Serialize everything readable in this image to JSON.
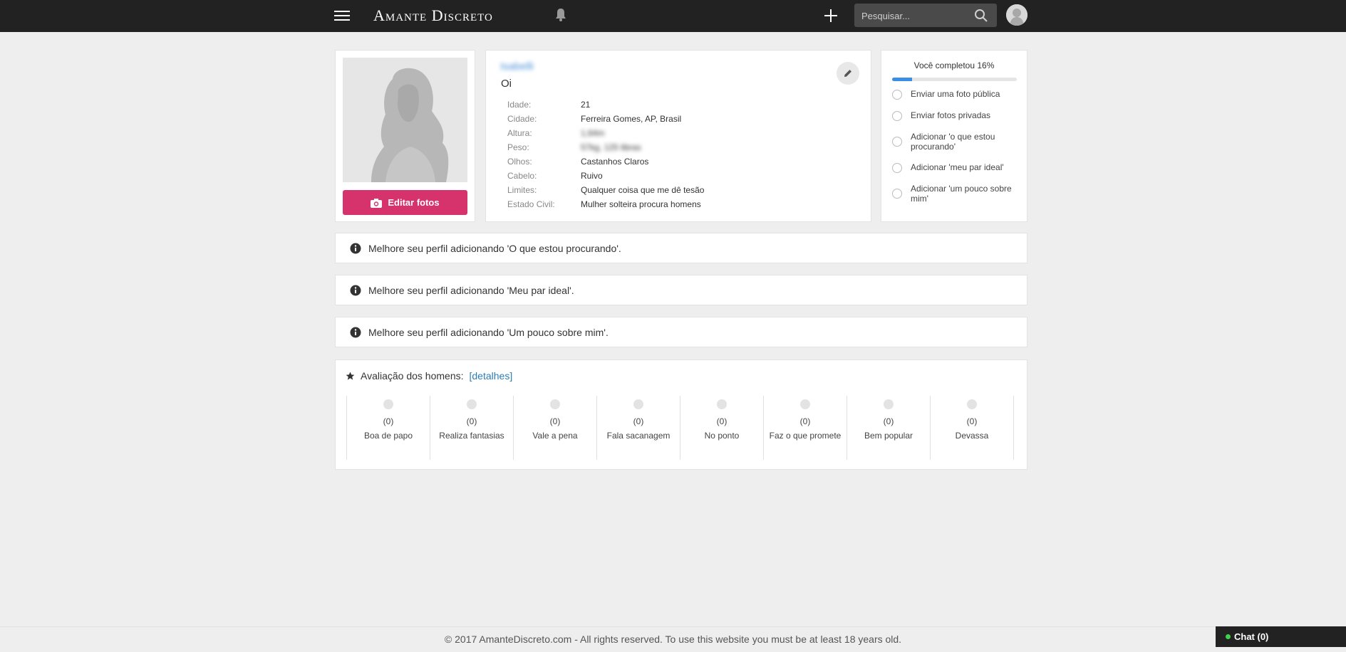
{
  "header": {
    "logo": "Amante Discreto",
    "search_placeholder": "Pesquisar..."
  },
  "profile": {
    "edit_photos_label": "Editar fotos",
    "username": "Isabelli",
    "status": "Oi",
    "details": [
      {
        "label": "Idade:",
        "value": "21",
        "hidden": false
      },
      {
        "label": "Cidade:",
        "value": "Ferreira Gomes, AP, Brasil",
        "hidden": false
      },
      {
        "label": "Altura:",
        "value": "1,64m",
        "hidden": true
      },
      {
        "label": "Peso:",
        "value": "57kg, 125 libras",
        "hidden": true
      },
      {
        "label": "Olhos:",
        "value": "Castanhos Claros",
        "hidden": false
      },
      {
        "label": "Cabelo:",
        "value": "Ruivo",
        "hidden": false
      },
      {
        "label": "Limites:",
        "value": "Qualquer coisa que me dê tesão",
        "hidden": false
      },
      {
        "label": "Estado Civil:",
        "value": "Mulher solteira procura homens",
        "hidden": false
      }
    ]
  },
  "completion": {
    "title": "Você completou 16%",
    "percent": 16,
    "tasks": [
      "Enviar uma foto pública",
      "Enviar fotos privadas",
      "Adicionar 'o que estou procurando'",
      "Adicionar 'meu par ideal'",
      "Adicionar 'um pouco sobre mim'"
    ]
  },
  "notices": [
    "Melhore seu perfil adicionando 'O que estou procurando'.",
    "Melhore seu perfil adicionando 'Meu par ideal'.",
    "Melhore seu perfil adicionando 'Um pouco sobre mim'."
  ],
  "rating": {
    "title": "Avaliação dos homens:",
    "details_link": "[detalhes]",
    "items": [
      {
        "count": "(0)",
        "label": "Boa de papo"
      },
      {
        "count": "(0)",
        "label": "Realiza fantasias"
      },
      {
        "count": "(0)",
        "label": "Vale a pena"
      },
      {
        "count": "(0)",
        "label": "Fala sacanagem"
      },
      {
        "count": "(0)",
        "label": "No ponto"
      },
      {
        "count": "(0)",
        "label": "Faz o que promete"
      },
      {
        "count": "(0)",
        "label": "Bem popular"
      },
      {
        "count": "(0)",
        "label": "Devassa"
      }
    ]
  },
  "footer": {
    "text": "© 2017 AmanteDiscreto.com - All rights reserved. To use this website you must be at least 18 years old.",
    "chat_label": "Chat (0)"
  },
  "colors": {
    "topbar": "#222222",
    "accent_button": "#d6336c",
    "progress": "#3a8ee6",
    "link": "#2a7db5"
  }
}
